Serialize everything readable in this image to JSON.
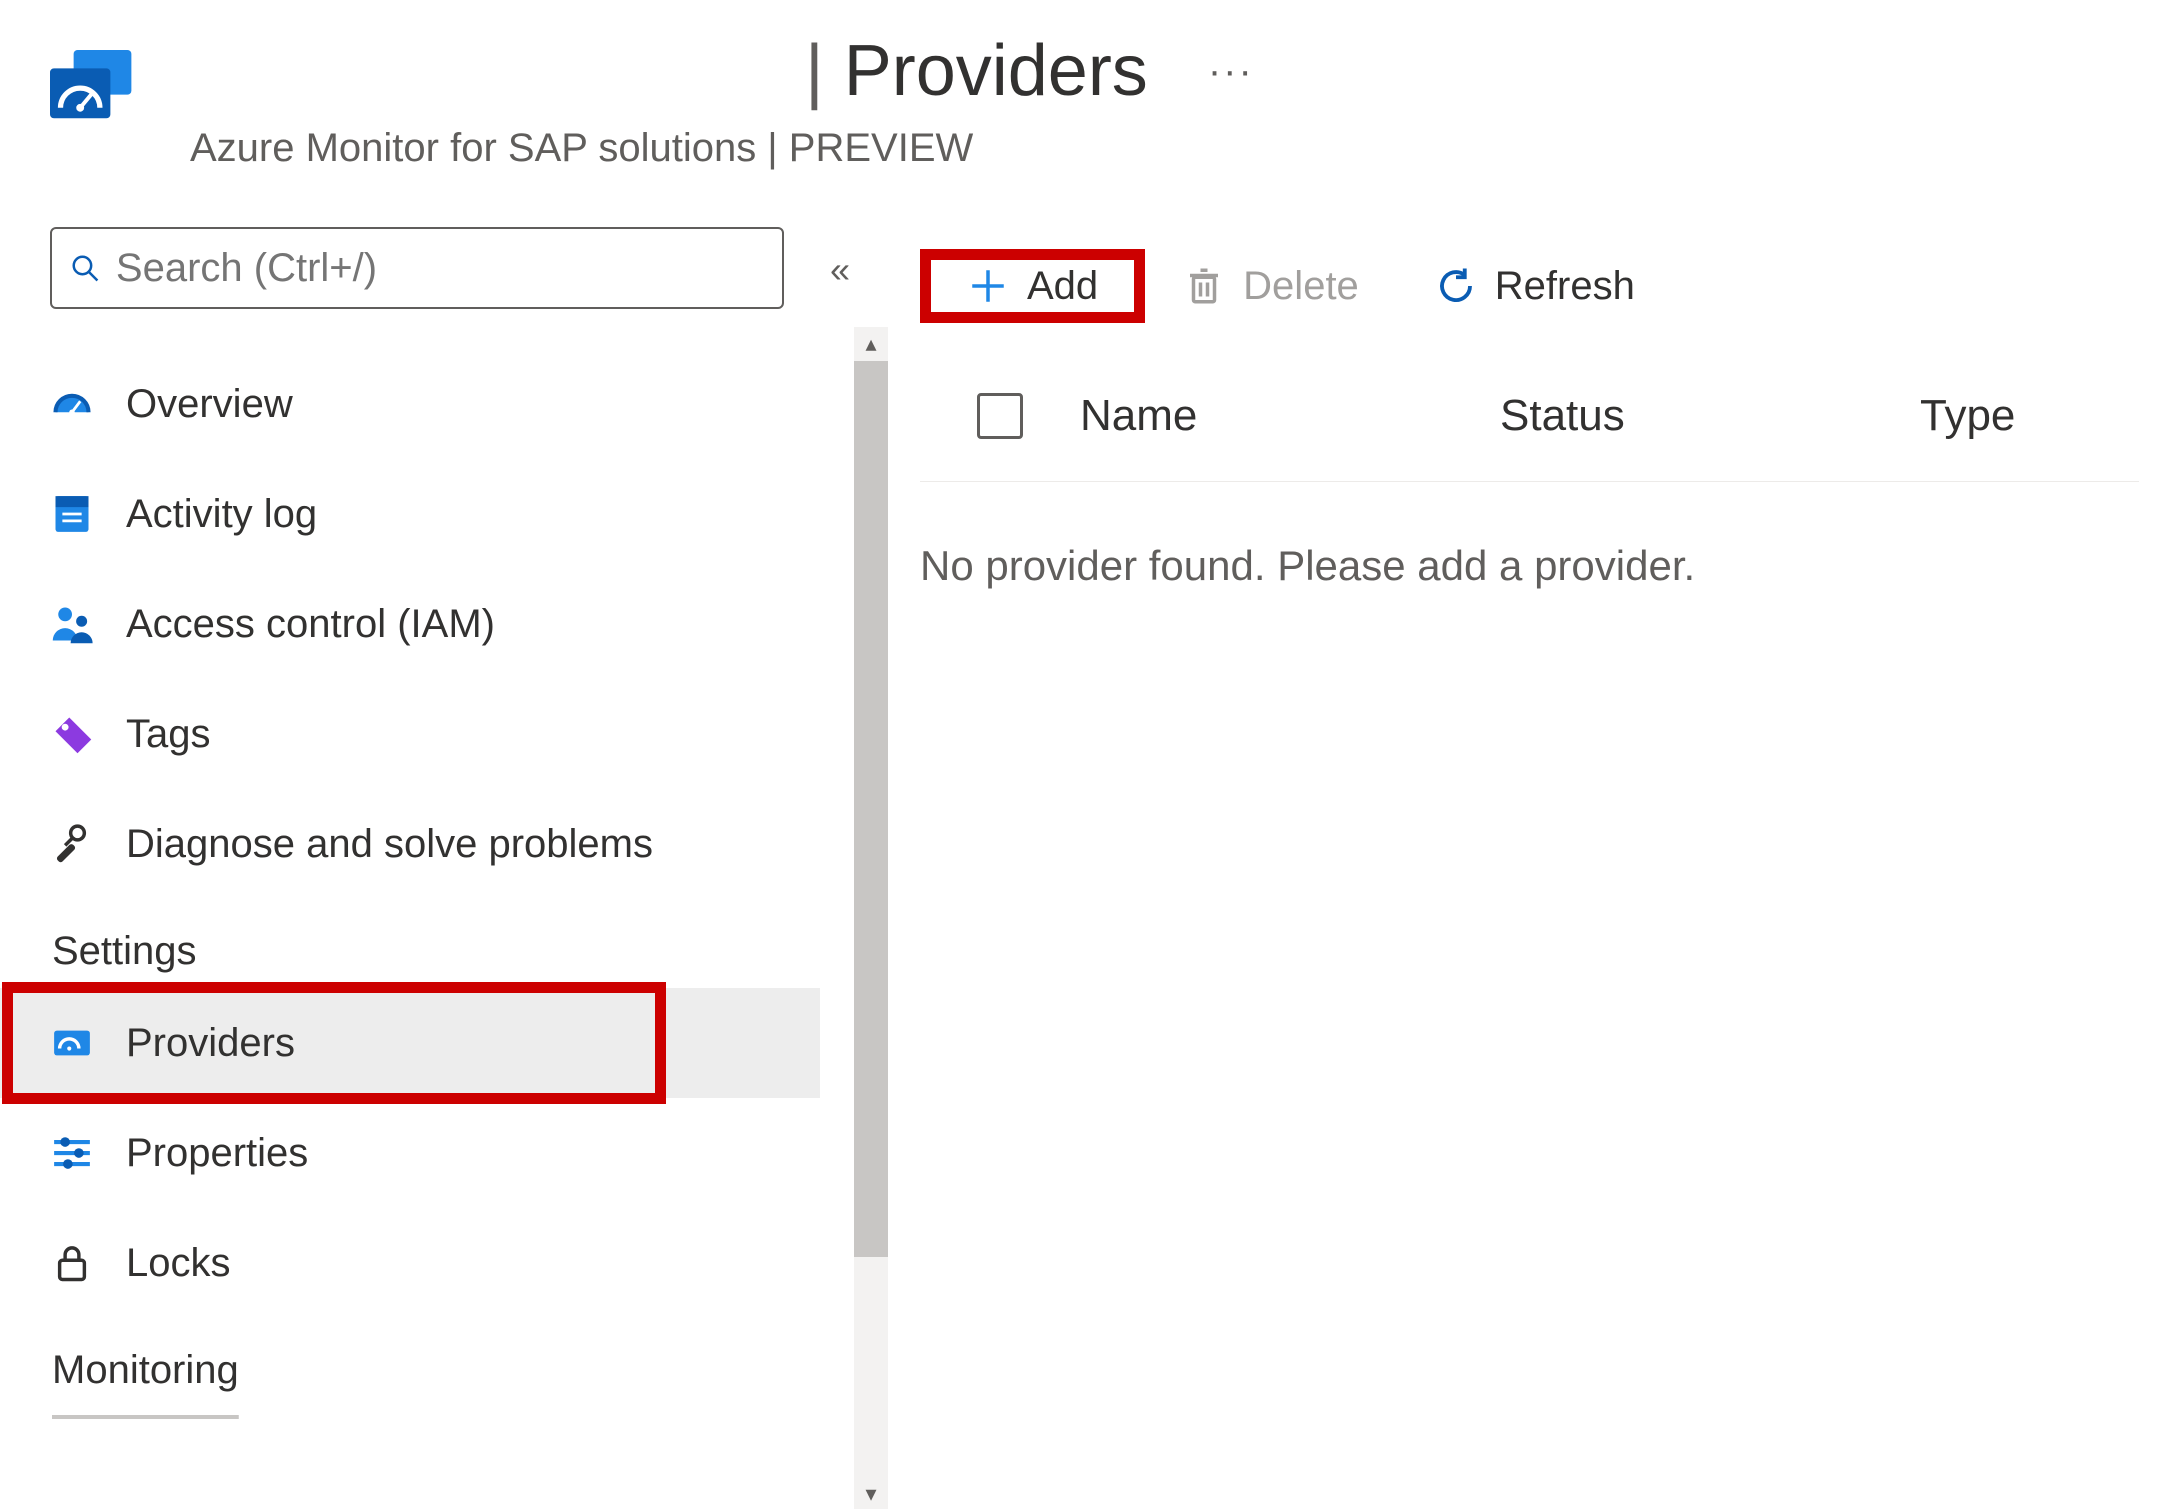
{
  "header": {
    "divider": "|",
    "title": "Providers",
    "more": "···",
    "subtitle": "Azure Monitor for SAP solutions | PREVIEW"
  },
  "search": {
    "placeholder": "Search (Ctrl+/)"
  },
  "nav": {
    "items": [
      {
        "label": "Overview"
      },
      {
        "label": "Activity log"
      },
      {
        "label": "Access control (IAM)"
      },
      {
        "label": "Tags"
      },
      {
        "label": "Diagnose and solve problems"
      }
    ],
    "section_settings": "Settings",
    "settings_items": [
      {
        "label": "Providers"
      },
      {
        "label": "Properties"
      },
      {
        "label": "Locks"
      }
    ],
    "section_monitoring": "Monitoring"
  },
  "toolbar": {
    "add": "Add",
    "delete": "Delete",
    "refresh": "Refresh"
  },
  "table": {
    "cols": {
      "name": "Name",
      "status": "Status",
      "type": "Type"
    },
    "empty": "No provider found. Please add a provider."
  }
}
